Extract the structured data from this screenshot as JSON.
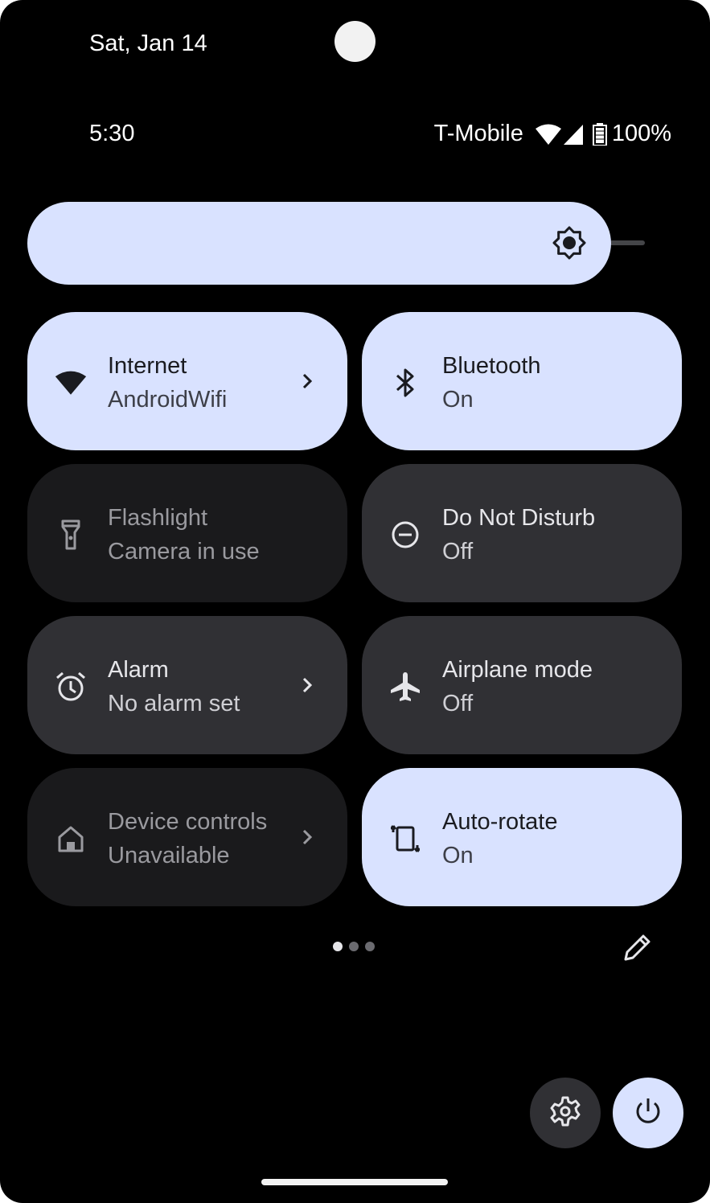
{
  "status": {
    "date": "Sat, Jan 14",
    "time": "5:30",
    "carrier": "T-Mobile",
    "battery": "100%"
  },
  "brightness": {
    "level": 0.92
  },
  "tiles": [
    {
      "title": "Internet",
      "subtitle": "AndroidWifi",
      "state": "active",
      "icon": "wifi-icon"
    },
    {
      "title": "Bluetooth",
      "subtitle": "On",
      "state": "active",
      "icon": "bluetooth-icon"
    },
    {
      "title": "Flashlight",
      "subtitle": "Camera in use",
      "state": "unavailable",
      "icon": "flashlight-icon"
    },
    {
      "title": "Do Not Disturb",
      "subtitle": "Off",
      "state": "inactive",
      "icon": "do-not-disturb-icon"
    },
    {
      "title": "Alarm",
      "subtitle": "No alarm set",
      "state": "inactive",
      "icon": "alarm-icon"
    },
    {
      "title": "Airplane mode",
      "subtitle": "Off",
      "state": "inactive",
      "icon": "airplane-icon"
    },
    {
      "title": "Device controls",
      "subtitle": "Unavailable",
      "state": "unavailable",
      "icon": "home-icon"
    },
    {
      "title": "Auto-rotate",
      "subtitle": "On",
      "state": "active",
      "icon": "auto-rotate-icon"
    }
  ],
  "pager": {
    "current_page": 1,
    "total_pages": 3
  },
  "colors": {
    "active_tile": "#d9e2ff",
    "inactive_tile": "#303034",
    "background": "#000000"
  }
}
